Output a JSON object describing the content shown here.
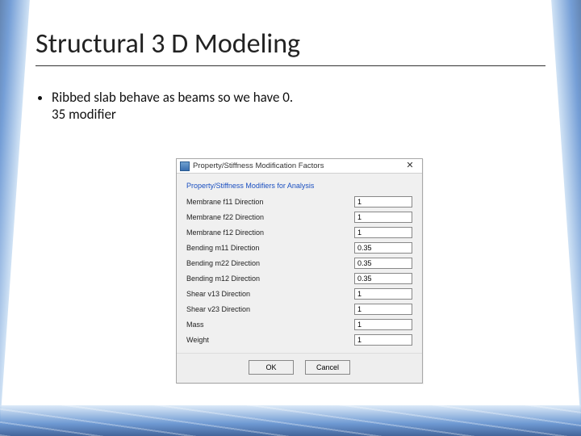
{
  "slide": {
    "title": "Structural 3 D Modeling",
    "bullet": "Ribbed slab behave as beams so we have 0. 35 modifier"
  },
  "dialog": {
    "title": "Property/Stiffness Modification Factors",
    "group_label": "Property/Stiffness Modifiers for Analysis",
    "fields": [
      {
        "label": "Membrane f11 Direction",
        "value": "1"
      },
      {
        "label": "Membrane f22 Direction",
        "value": "1"
      },
      {
        "label": "Membrane f12 Direction",
        "value": "1"
      },
      {
        "label": "Bending m11 Direction",
        "value": "0.35"
      },
      {
        "label": "Bending m22 Direction",
        "value": "0.35"
      },
      {
        "label": "Bending m12 Direction",
        "value": "0.35"
      },
      {
        "label": "Shear v13 Direction",
        "value": "1"
      },
      {
        "label": "Shear v23 Direction",
        "value": "1"
      },
      {
        "label": "Mass",
        "value": "1"
      },
      {
        "label": "Weight",
        "value": "1"
      }
    ],
    "ok": "OK",
    "cancel": "Cancel"
  }
}
